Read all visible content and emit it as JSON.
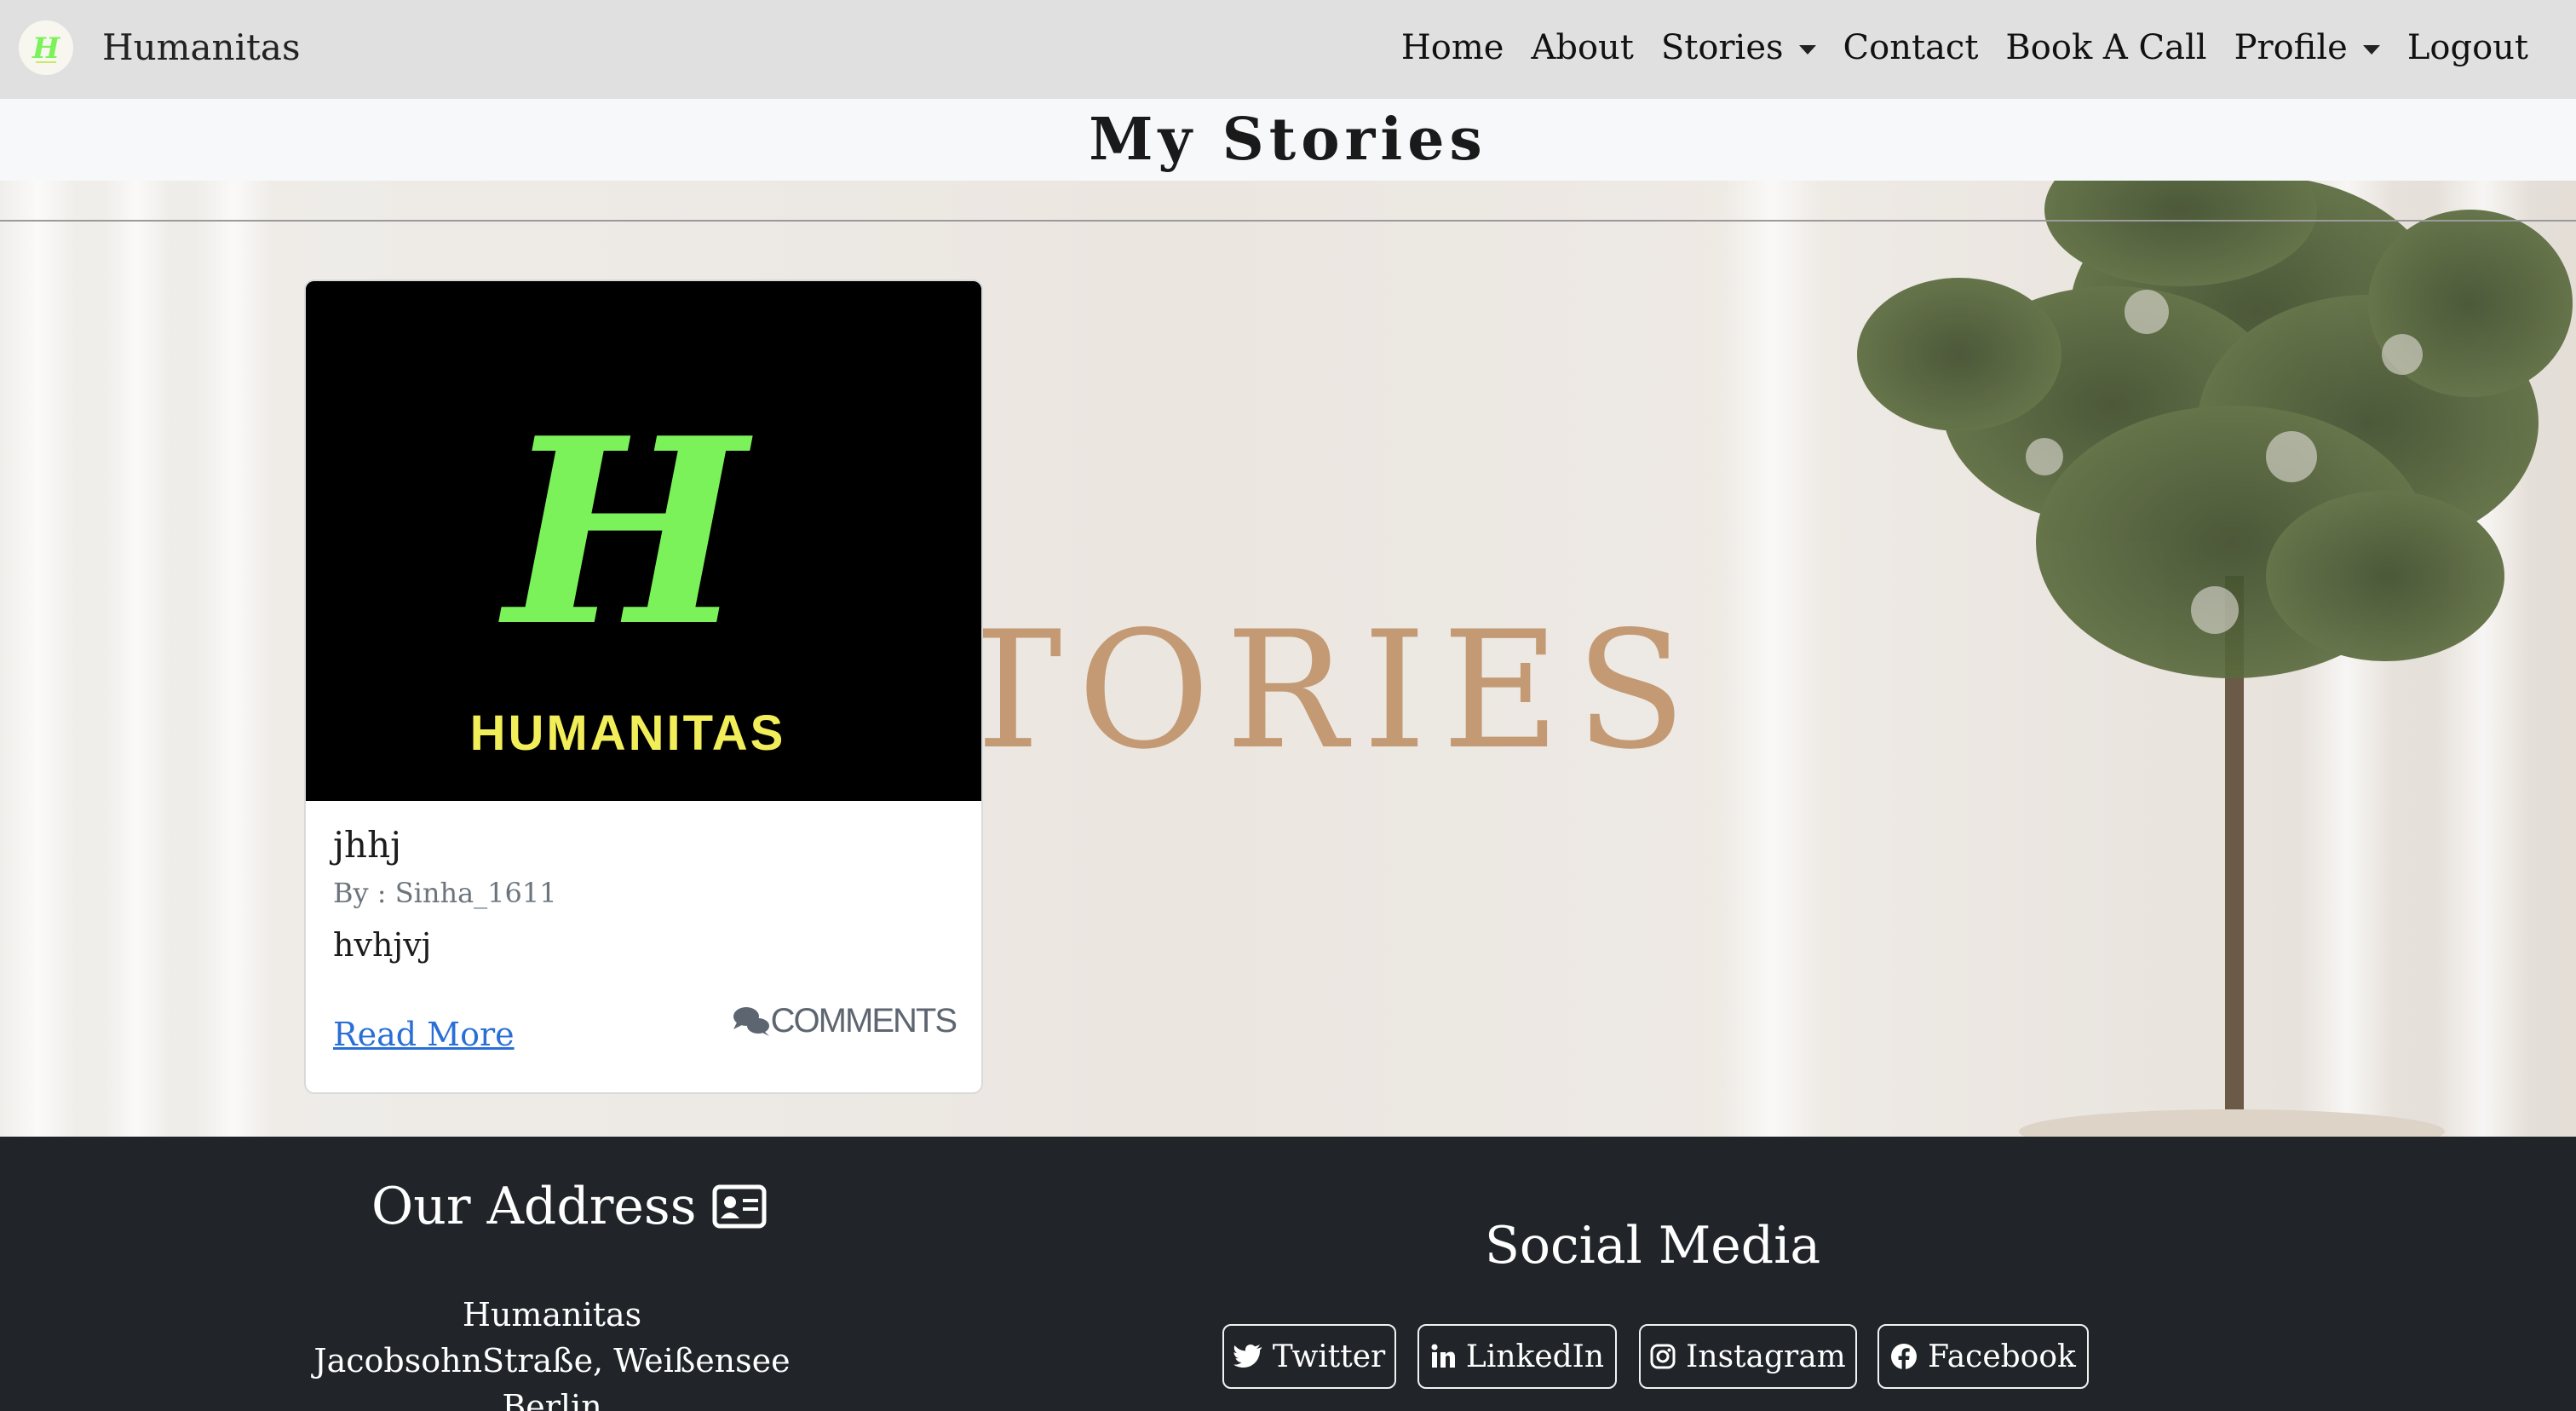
{
  "navbar": {
    "brand_name": "Humanitas",
    "brand_logo_letter": "H",
    "links": [
      "Home",
      "About",
      "Stories",
      "Contact",
      "Book A Call",
      "Profile",
      "Logout"
    ]
  },
  "page": {
    "title": "My Stories"
  },
  "hero": {
    "background_text": "TORIES"
  },
  "card": {
    "image_letter": "H",
    "image_brand": "HUMANITAS",
    "title": "jhhj",
    "author": "By : Sinha_1611",
    "text": "hvhjvj",
    "read_more": "Read More",
    "comments": "COMMENTS"
  },
  "footer": {
    "address_title": "Our Address",
    "address_lines": [
      "Humanitas",
      "JacobsohnStraße, Weißensee",
      "Berlin"
    ],
    "social_title": "Social Media",
    "social_buttons": [
      "Twitter",
      "LinkedIn",
      "Instagram",
      "Facebook"
    ]
  },
  "colors": {
    "navbar_bg": "#e0e0e0",
    "footer_bg": "#212529",
    "logo_green": "#7cf25a",
    "logo_yellow": "#f2ee5a",
    "link_blue": "#2a6fd6"
  }
}
